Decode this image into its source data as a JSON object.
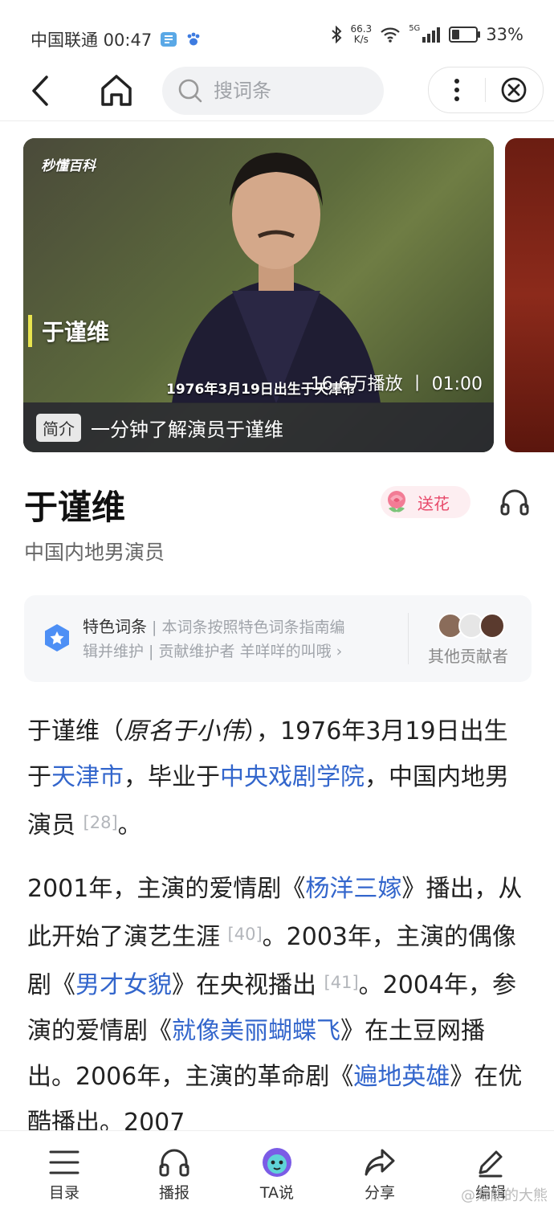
{
  "status": {
    "carrier_time": "中国联通 00:47",
    "net_speed": "66.3",
    "net_unit": "K/s",
    "net_type": "5G",
    "battery_text": "33%",
    "battery_level": 0.33,
    "icons": [
      "book-icon",
      "paw-icon",
      "bluetooth-icon",
      "wifi-icon",
      "signal-icon",
      "battery-icon"
    ]
  },
  "topbar": {
    "search_placeholder": "搜词条",
    "icons": [
      "back-icon",
      "home-icon",
      "search-icon",
      "more-icon",
      "close-icon"
    ]
  },
  "video": {
    "brand": "秒懂百科",
    "name_overlay": "于谨维",
    "subtitle": "1976年3月19日出生于天津市",
    "meta": "16.6万播放 丨 01:00",
    "tag": "简介",
    "title": "一分钟了解演员于谨维"
  },
  "entry": {
    "title": "于谨维",
    "flower_label": "送花",
    "subtitle": "中国内地男演员"
  },
  "feature": {
    "label": "特色词条",
    "line1": "本词条按照特色词条指南编",
    "line2": "辑并维护",
    "maintainer_label": "贡献维护者",
    "maintainer": "羊咩咩的叫哦",
    "contributors_label": "其他贡献者"
  },
  "article": {
    "p1": {
      "a": "于谨维（",
      "orig": "原名于小伟",
      "b": "），1976年3月19日出生于",
      "link1": "天津市",
      "c": "，毕业于",
      "link2": "中央戏剧学院",
      "d": "，中国内地男演员",
      "ref1": "[28]",
      "e": "。"
    },
    "p2": {
      "a": "2001年，主演的爱情剧《",
      "link1": "杨洋三嫁",
      "b": "》播出，从此开始了演艺生涯",
      "ref1": "[40]",
      "c": "。2003年，主演的偶像剧《",
      "link2": "男才女貌",
      "d": "》在央视播出",
      "ref2": "[41]",
      "e": "。2004年，参演的爱情剧《",
      "link3": "就像美丽蝴蝶飞",
      "f": "》在土豆网播出。2006年，主演的革命剧《",
      "link4": "遍地英雄",
      "g": "》在优酷播出。2007"
    }
  },
  "bottom_tabs": [
    {
      "label": "目录"
    },
    {
      "label": "播报"
    },
    {
      "label": "TA说"
    },
    {
      "label": "分享"
    },
    {
      "label": "编辑"
    }
  ],
  "watermark": "@万能的大熊"
}
